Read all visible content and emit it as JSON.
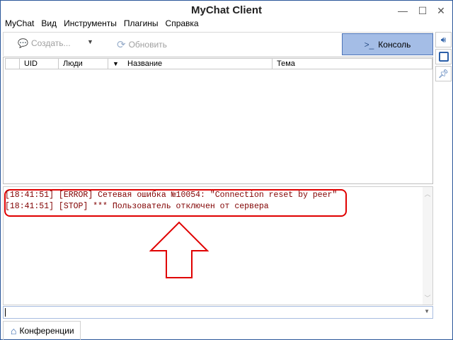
{
  "window": {
    "title": "MyChat Client"
  },
  "menu": [
    "MyChat",
    "Вид",
    "Инструменты",
    "Плагины",
    "Справка"
  ],
  "toolbar": {
    "create_label": "Создать...",
    "refresh_label": "Обновить",
    "console_label": "Консоль",
    "console_prompt": ">_"
  },
  "table": {
    "columns": [
      "UID",
      "Люди",
      "Название",
      "Тема"
    ]
  },
  "log": {
    "lines": [
      "[18:41:51] [ERROR] Сетевая ошибка №10054: \"Connection reset by peer\"",
      "[18:41:51] [STOP] *** Пользователь отключен от сервера"
    ]
  },
  "input": {
    "value": ""
  },
  "tabs": [
    {
      "label": "Конференции",
      "icon": "home-icon"
    }
  ],
  "colors": {
    "accent": "#a4bde6",
    "log_text": "#800000",
    "highlight": "#e00000"
  }
}
